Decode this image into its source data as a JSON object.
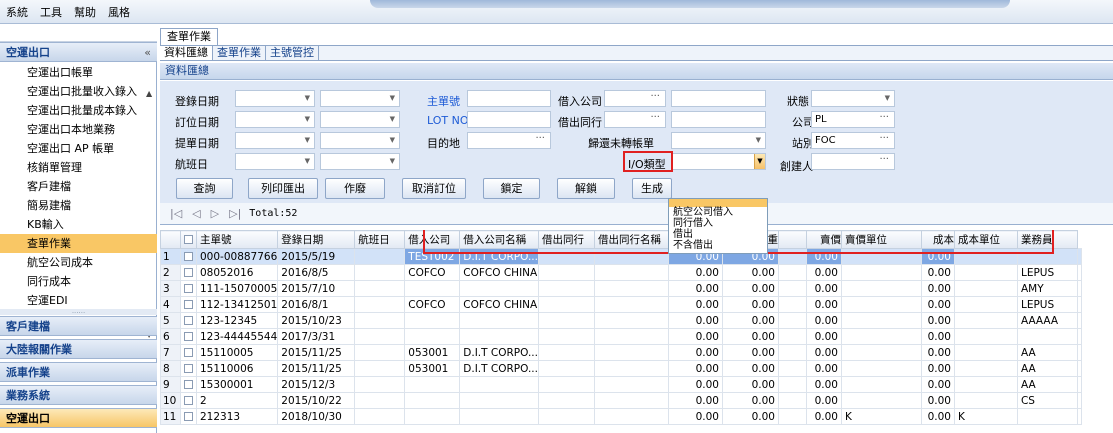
{
  "menubar": {
    "items": [
      "系統",
      "工具",
      "幫助",
      "風格"
    ]
  },
  "sidebar": {
    "group_active": "空運出口",
    "collapse_glyph": "«",
    "items": [
      "空運出口帳單",
      "空運出口批量收入錄入",
      "空運出口批量成本錄入",
      "空運出口本地業務",
      "空運出口 AP 帳單",
      "核銷單管理",
      "客戶建檔",
      "簡易建檔",
      "KB輸入",
      "查單作業",
      "航空公司成本",
      "同行成本",
      "空運EDI"
    ],
    "selected_index": 9,
    "grip": "......",
    "groups": [
      "客戶建檔",
      "大陸報關作業",
      "派車作業",
      "業務系統",
      "空運出口"
    ]
  },
  "doc_tab": "查單作業",
  "subtabs": [
    "資料匯總",
    "查單作業",
    "主號管控"
  ],
  "panel_title": "資料匯總",
  "form": {
    "register_date": "登錄日期",
    "book_date": "訂位日期",
    "lading_date": "提單日期",
    "flight_date": "航班日",
    "mawb": "主單號",
    "lot_no": "LOT NO",
    "destination": "目的地",
    "lend_company": "借入公司",
    "lend_out_peer": "借出同行",
    "return_unbilled": "歸還未轉帳單",
    "io_type": "I/O類型",
    "status": "狀態",
    "company": "公司",
    "company_val": "PL",
    "station": "站別",
    "station_val": "FOC",
    "creator": "創建人"
  },
  "io_options": [
    "",
    "航空公司借入",
    "同行借入",
    "借出",
    "不含借出"
  ],
  "buttons": [
    "查詢",
    "列印匯出",
    "作廢",
    "取消訂位",
    "鎖定",
    "解鎖",
    "生成"
  ],
  "pager": {
    "first": "|◁",
    "prev": "◁",
    "next": "▷",
    "last": "▷|",
    "total": "Total:52"
  },
  "columns": [
    "",
    "主單號",
    "登錄日期",
    "航班日",
    "借入公司",
    "借入公司名稱",
    "借出同行",
    "借出同行名稱",
    "毛重",
    "體積重",
    "",
    "賣價",
    "賣價單位",
    "成本",
    "成本單位",
    "業務員"
  ],
  "rows": [
    {
      "no": "1",
      "mawb": "000-00887766",
      "date": "2015/5/19",
      "flight": "",
      "lc": "TEST002",
      "lcname": "D.I.T CORPO...",
      "peer": "",
      "peername": "",
      "gw": "0.00",
      "vw": "0.00",
      "sell": "0.00",
      "sellu": "",
      "cost": "0.00",
      "costu": "",
      "sales": ""
    },
    {
      "no": "2",
      "mawb": "08052016",
      "date": "2016/8/5",
      "flight": "",
      "lc": "COFCO",
      "lcname": "COFCO CHINA",
      "peer": "",
      "peername": "",
      "gw": "0.00",
      "vw": "0.00",
      "sell": "0.00",
      "sellu": "",
      "cost": "0.00",
      "costu": "",
      "sales": "LEPUS"
    },
    {
      "no": "3",
      "mawb": "111-15070005",
      "date": "2015/7/10",
      "flight": "",
      "lc": "",
      "lcname": "",
      "peer": "",
      "peername": "",
      "gw": "0.00",
      "vw": "0.00",
      "sell": "0.00",
      "sellu": "",
      "cost": "0.00",
      "costu": "",
      "sales": "AMY"
    },
    {
      "no": "4",
      "mawb": "112-13412501",
      "date": "2016/8/1",
      "flight": "",
      "lc": "COFCO",
      "lcname": "COFCO CHINA",
      "peer": "",
      "peername": "",
      "gw": "0.00",
      "vw": "0.00",
      "sell": "0.00",
      "sellu": "",
      "cost": "0.00",
      "costu": "",
      "sales": "LEPUS"
    },
    {
      "no": "5",
      "mawb": "123-12345",
      "date": "2015/10/23",
      "flight": "",
      "lc": "",
      "lcname": "",
      "peer": "",
      "peername": "",
      "gw": "0.00",
      "vw": "0.00",
      "sell": "0.00",
      "sellu": "",
      "cost": "0.00",
      "costu": "",
      "sales": "AAAAA"
    },
    {
      "no": "6",
      "mawb": "123-44445544",
      "date": "2017/3/31",
      "flight": "",
      "lc": "",
      "lcname": "",
      "peer": "",
      "peername": "",
      "gw": "0.00",
      "vw": "0.00",
      "sell": "0.00",
      "sellu": "",
      "cost": "0.00",
      "costu": "",
      "sales": ""
    },
    {
      "no": "7",
      "mawb": "15110005",
      "date": "2015/11/25",
      "flight": "",
      "lc": "053001",
      "lcname": "D.I.T CORPO...",
      "peer": "",
      "peername": "",
      "gw": "0.00",
      "vw": "0.00",
      "sell": "0.00",
      "sellu": "",
      "cost": "0.00",
      "costu": "",
      "sales": "AA"
    },
    {
      "no": "8",
      "mawb": "15110006",
      "date": "2015/11/25",
      "flight": "",
      "lc": "053001",
      "lcname": "D.I.T CORPO...",
      "peer": "",
      "peername": "",
      "gw": "0.00",
      "vw": "0.00",
      "sell": "0.00",
      "sellu": "",
      "cost": "0.00",
      "costu": "",
      "sales": "AA"
    },
    {
      "no": "9",
      "mawb": "15300001",
      "date": "2015/12/3",
      "flight": "",
      "lc": "",
      "lcname": "",
      "peer": "",
      "peername": "",
      "gw": "0.00",
      "vw": "0.00",
      "sell": "0.00",
      "sellu": "",
      "cost": "0.00",
      "costu": "",
      "sales": "AA"
    },
    {
      "no": "10",
      "mawb": "2",
      "date": "2015/10/22",
      "flight": "",
      "lc": "",
      "lcname": "",
      "peer": "",
      "peername": "",
      "gw": "0.00",
      "vw": "0.00",
      "sell": "0.00",
      "sellu": "",
      "cost": "0.00",
      "costu": "",
      "sales": "CS"
    },
    {
      "no": "11",
      "mawb": "212313",
      "date": "2018/10/30",
      "flight": "",
      "lc": "",
      "lcname": "",
      "peer": "",
      "peername": "",
      "gw": "0.00",
      "vw": "0.00",
      "sell": "0.00",
      "sellu": "K",
      "cost": "0.00",
      "costu": "K",
      "sales": ""
    }
  ]
}
